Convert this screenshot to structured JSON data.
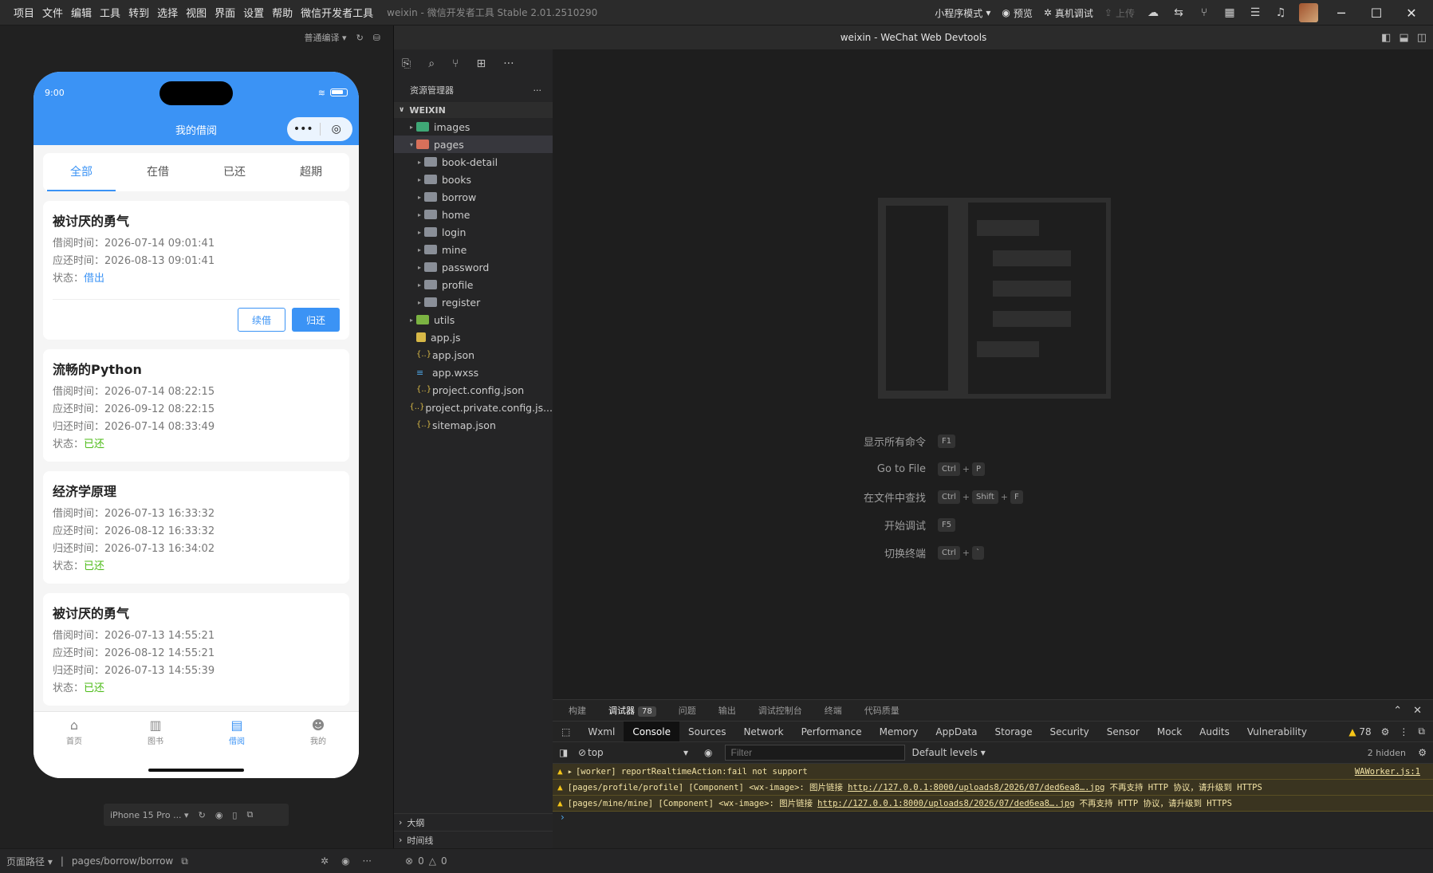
{
  "titlebar": {
    "menus": [
      "项目",
      "文件",
      "编辑",
      "工具",
      "转到",
      "选择",
      "视图",
      "界面",
      "设置",
      "帮助",
      "微信开发者工具"
    ],
    "app_title": "weixin - 微信开发者工具 Stable 2.01.2510290",
    "mode": "小程序模式",
    "preview": "预览",
    "real_debug": "真机调试",
    "upload": "上传"
  },
  "simulator": {
    "compile_mode": "普通编译",
    "time": "9:00",
    "page_title": "我的借阅",
    "tabs": [
      "全部",
      "在借",
      "已还",
      "超期"
    ],
    "active_tab": 0,
    "label_borrow": "借阅时间：",
    "label_due": "应还时间：",
    "label_return": "归还时间：",
    "label_status": "状态：",
    "cards": [
      {
        "title": "被讨厌的勇气",
        "borrow": "2026-07-14 09:01:41",
        "due": "2026-08-13 09:01:41",
        "status": "借出",
        "renew": "续借",
        "return_btn": "归还"
      },
      {
        "title": "流畅的Python",
        "borrow": "2026-07-14 08:22:15",
        "due": "2026-09-12 08:22:15",
        "returned": "2026-07-14 08:33:49",
        "status": "已还"
      },
      {
        "title": "经济学原理",
        "borrow": "2026-07-13 16:33:32",
        "due": "2026-08-12 16:33:32",
        "returned": "2026-07-13 16:34:02",
        "status": "已还"
      },
      {
        "title": "被讨厌的勇气",
        "borrow": "2026-07-13 14:55:21",
        "due": "2026-08-12 14:55:21",
        "returned": "2026-07-13 14:55:39",
        "status": "已还"
      }
    ],
    "tabbar": [
      "首页",
      "图书",
      "借阅",
      "我的"
    ],
    "device": "iPhone 15 Pro ..."
  },
  "statusbar": {
    "path_label": "页面路径",
    "path": "pages/borrow/borrow",
    "errors": "0",
    "warnings": "0"
  },
  "explorer": {
    "header": "资源管理器",
    "root": "WEIXIN",
    "items": [
      {
        "name": "images",
        "type": "folder-img",
        "depth": 0,
        "expanded": false
      },
      {
        "name": "pages",
        "type": "folder-red",
        "depth": 0,
        "expanded": true
      },
      {
        "name": "book-detail",
        "type": "folder",
        "depth": 1
      },
      {
        "name": "books",
        "type": "folder",
        "depth": 1
      },
      {
        "name": "borrow",
        "type": "folder",
        "depth": 1
      },
      {
        "name": "home",
        "type": "folder",
        "depth": 1
      },
      {
        "name": "login",
        "type": "folder",
        "depth": 1
      },
      {
        "name": "mine",
        "type": "folder",
        "depth": 1
      },
      {
        "name": "password",
        "type": "folder",
        "depth": 1
      },
      {
        "name": "profile",
        "type": "folder",
        "depth": 1
      },
      {
        "name": "register",
        "type": "folder",
        "depth": 1
      },
      {
        "name": "utils",
        "type": "folder-util",
        "depth": 0
      },
      {
        "name": "app.js",
        "type": "js",
        "depth": 0
      },
      {
        "name": "app.json",
        "type": "json",
        "depth": 0
      },
      {
        "name": "app.wxss",
        "type": "css",
        "depth": 0
      },
      {
        "name": "project.config.json",
        "type": "json",
        "depth": 0
      },
      {
        "name": "project.private.config.js...",
        "type": "json",
        "depth": 0
      },
      {
        "name": "sitemap.json",
        "type": "json",
        "depth": 0
      }
    ],
    "outline": "大纲",
    "timeline": "时间线"
  },
  "editor": {
    "title": "weixin - WeChat Web Devtools",
    "shortcuts": [
      {
        "label": "显示所有命令",
        "keys": [
          "F1"
        ]
      },
      {
        "label": "Go to File",
        "keys": [
          "Ctrl",
          "P"
        ]
      },
      {
        "label": "在文件中查找",
        "keys": [
          "Ctrl",
          "Shift",
          "F"
        ]
      },
      {
        "label": "开始调试",
        "keys": [
          "F5"
        ]
      },
      {
        "label": "切换终端",
        "keys": [
          "Ctrl",
          "`"
        ]
      }
    ]
  },
  "devtools": {
    "top_tabs": [
      "构建",
      "调试器",
      "问题",
      "输出",
      "调试控制台",
      "终端",
      "代码质量"
    ],
    "debugger_badge": "78",
    "panel_tabs": [
      "Wxml",
      "Console",
      "Sources",
      "Network",
      "Performance",
      "Memory",
      "AppData",
      "Storage",
      "Security",
      "Sensor",
      "Mock",
      "Audits",
      "Vulnerability"
    ],
    "warning_count": "78",
    "context": "top",
    "filter_placeholder": "Filter",
    "levels": "Default levels",
    "hidden": "2 hidden",
    "logs": [
      {
        "text": "[worker] reportRealtimeAction:fail not support",
        "source": "WAWorker.js:1"
      },
      {
        "prefix": "[pages/profile/profile] [Component] <wx-image>: 图片链接",
        "link": "http://127.0.0.1:8000/uploads8/2026/07/ded6ea8….jpg",
        "suffix": "不再支持 HTTP 协议，请升级到 HTTPS"
      },
      {
        "prefix": "[pages/mine/mine] [Component] <wx-image>: 图片链接",
        "link": "http://127.0.0.1:8000/uploads8/2026/07/ded6ea8….jpg",
        "suffix": "不再支持 HTTP 协议，请升级到 HTTPS"
      }
    ]
  }
}
